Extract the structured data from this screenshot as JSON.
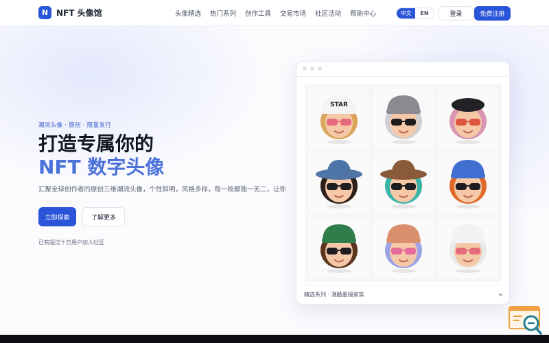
{
  "header": {
    "logo_mark": "N",
    "logo_text": "NFT 头像馆",
    "nav": [
      "头像精选",
      "热门系列",
      "创作工具",
      "交易市场",
      "社区活动",
      "帮助中心"
    ],
    "lang": {
      "active": "中文",
      "other": "EN"
    },
    "login_label": "登录",
    "signup_label": "免费注册"
  },
  "hero": {
    "eyebrow": "潮流头像 · 原创 · 限量发行",
    "title_line1": "打造专属你的",
    "title_line2": "NFT 数字头像",
    "description": "汇聚全球创作者的原创三维潮流头像，个性鲜明，风格多样，每一枚都独一无二，让你的数字身份在社区中脱颖而出。",
    "primary_button": "立即探索",
    "secondary_button": "了解更多",
    "note": "已有超过十万用户加入社区"
  },
  "preview": {
    "caption": "精选系列 · 潮酷墨镜家族",
    "avatars": [
      {
        "name": "star-cap",
        "hair": "#d9a65a",
        "hat": "#f4f4f4",
        "glasses": "#e46a7c",
        "hat_text": "STAR"
      },
      {
        "name": "gray-beanie",
        "hair": "#cfcfd4",
        "hat": "#8a8a90",
        "glasses": "#1d1d1f"
      },
      {
        "name": "black-beret",
        "hair": "#d993b3",
        "hat": "#222226",
        "glasses": "#e0553f"
      },
      {
        "name": "cowboy-blue",
        "hair": "#2d1f1a",
        "hat": "#4f74a6",
        "glasses": "#1d1d1f"
      },
      {
        "name": "brown-fedora",
        "hair": "#3bb3a7",
        "hat": "#8a5a3a",
        "glasses": "#1d1d1f"
      },
      {
        "name": "blue-cap",
        "hair": "#e06a2a",
        "hat": "#3f6fd1",
        "glasses": "#1d1d1f"
      },
      {
        "name": "green-beanie",
        "hair": "#5b3520",
        "hat": "#2f7d4a",
        "glasses": "#1d1d1f"
      },
      {
        "name": "rainbow-beanie",
        "hair": "#9ea3e6",
        "hat": "#d98f6b",
        "glasses": "#e46a9a"
      },
      {
        "name": "white-beanie",
        "hair": "#e9e9ec",
        "hat": "#f2f2f4",
        "glasses": "#e46a7c"
      }
    ]
  },
  "colors": {
    "accent": "#2a55d8",
    "title_blue": "#4a72d9"
  }
}
